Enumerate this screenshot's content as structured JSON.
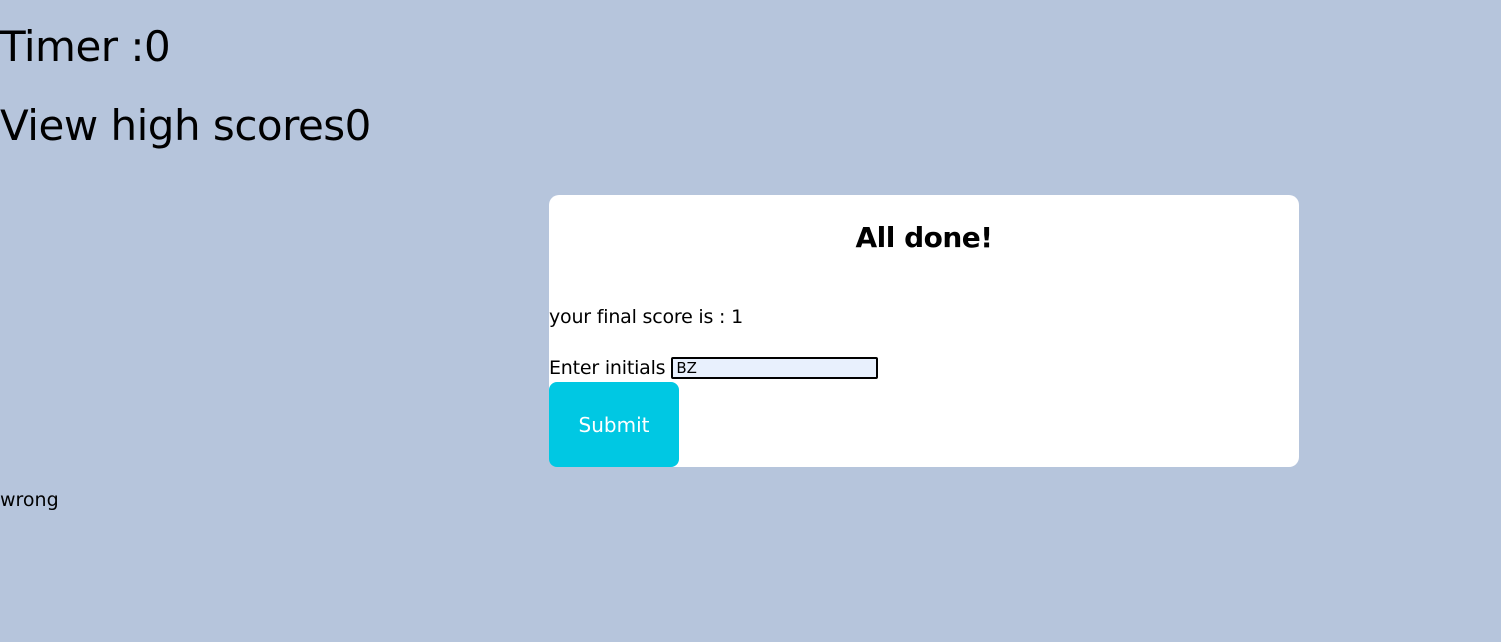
{
  "header": {
    "timer_text": "Timer :0",
    "high_scores_text": "View high scores0"
  },
  "card": {
    "title": "All done!",
    "final_score_text": "your final score is : 1",
    "initials_label": "Enter initials",
    "initials_value": "BZ",
    "submit_label": "Submit"
  },
  "feedback": {
    "text": "wrong"
  },
  "colors": {
    "background": "#b6c5dc",
    "card": "#ffffff",
    "submit_button": "#00c8e3",
    "input_background": "#e8f0fd"
  }
}
